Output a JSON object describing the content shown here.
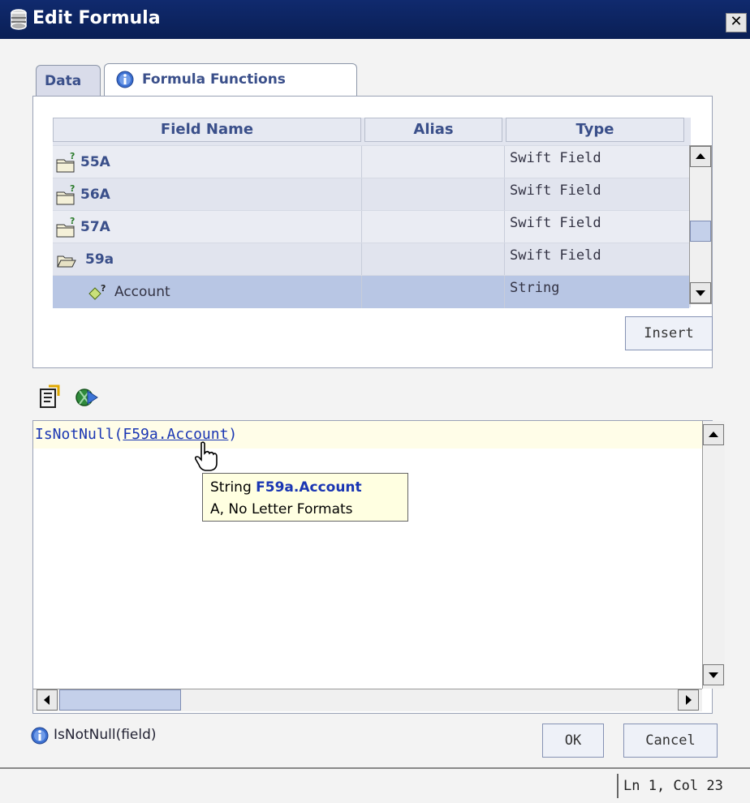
{
  "window": {
    "title": "Edit Formula",
    "close_label": "✕"
  },
  "tabs": [
    {
      "label": "Data"
    },
    {
      "label": "Formula Functions"
    }
  ],
  "grid": {
    "columns": [
      "Field Name",
      "Alias",
      "Type"
    ],
    "rows": [
      {
        "name": "55A",
        "alias": "",
        "type": "Swift Field",
        "icon": "folder-question-icon"
      },
      {
        "name": "56A",
        "alias": "",
        "type": "Swift Field",
        "icon": "folder-question-icon"
      },
      {
        "name": "57A",
        "alias": "",
        "type": "Swift Field",
        "icon": "folder-question-icon"
      },
      {
        "name": "59a",
        "alias": "",
        "type": "Swift Field",
        "icon": "folder-open-icon"
      },
      {
        "name": "Account",
        "alias": "",
        "type": "String",
        "icon": "diamond-question-icon",
        "selected": true
      }
    ]
  },
  "insert_label": "Insert",
  "toolbar": [
    {
      "icon": "clear-formula-icon"
    },
    {
      "icon": "validate-formula-icon"
    }
  ],
  "editor": {
    "code_prefix": "IsNotNull(",
    "code_link": "F59a.Account",
    "code_suffix": ")",
    "tooltip": {
      "type": "String",
      "name": "F59a.Account",
      "detail": "A, No Letter Formats"
    }
  },
  "hint": "IsNotNull(field)",
  "buttons": {
    "ok": "OK",
    "cancel": "Cancel"
  },
  "status": {
    "position": "Ln  1, Col 23"
  },
  "colors": {
    "titlebar": "#0a1f55",
    "accent": "#3a4f8a",
    "selected_row": "#b8c6e4",
    "tooltip": "#ffffe1"
  }
}
